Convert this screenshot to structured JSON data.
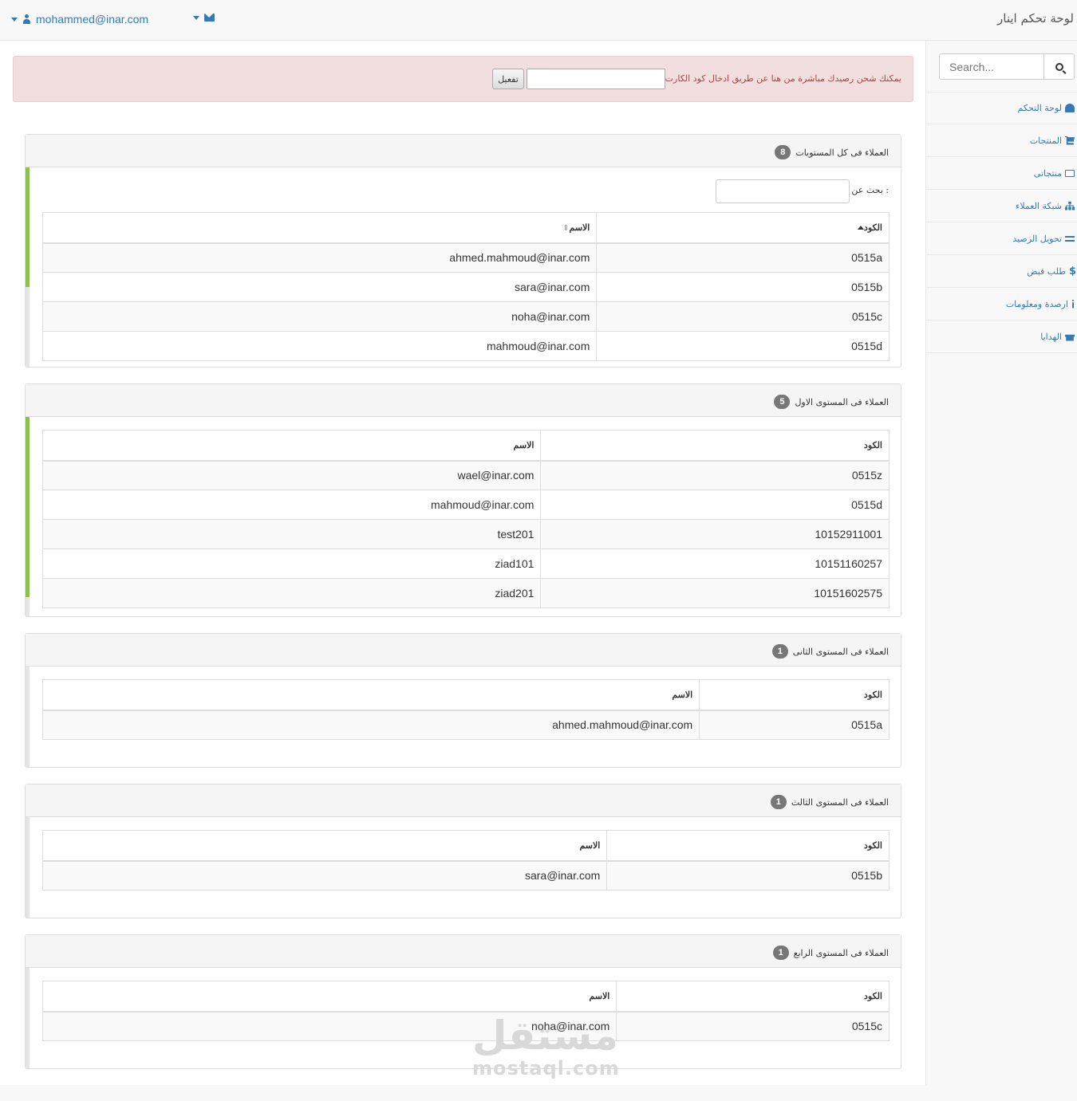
{
  "navbar": {
    "brand": "لوحة تحكم اينار",
    "user_email": "mohammed@inar.com"
  },
  "sidebar": {
    "search_placeholder": "Search...",
    "items": [
      {
        "label": "لوحة التحكم",
        "icon": "dashboard-icon"
      },
      {
        "label": "المنتجات",
        "icon": "shopping-cart-icon"
      },
      {
        "label": "منتجاتى",
        "icon": "folder-open-icon"
      },
      {
        "label": "شبكة العملاء",
        "icon": "sitemap-icon"
      },
      {
        "label": "تحويل الرصيد",
        "icon": "exchange-icon"
      },
      {
        "label": "طلب قبض",
        "icon": "dollar-icon"
      },
      {
        "label": "ارصدة ومعلومات",
        "icon": "info-icon"
      },
      {
        "label": "الهدايا",
        "icon": "gift-icon"
      }
    ]
  },
  "alert": {
    "text": "يمكنك شحن رصيدك مباشرة من هنا عن طريق ادخال كود الكارت",
    "button": "تفعيل",
    "card_code_value": ""
  },
  "panels": [
    {
      "title": "العملاء فى كل المستويات",
      "badge": "8",
      "search_label": "بحث عن :",
      "headers": {
        "code": "الكود",
        "name": "الاسم"
      },
      "rows": [
        {
          "code": "0515a",
          "name": "ahmed.mahmoud@inar.com"
        },
        {
          "code": "0515b",
          "name": "sara@inar.com"
        },
        {
          "code": "0515c",
          "name": "noha@inar.com"
        },
        {
          "code": "0515d",
          "name": "mahmoud@inar.com"
        }
      ]
    },
    {
      "title": "العملاء فى المستوى الاول",
      "badge": "5",
      "headers": {
        "code": "الكود",
        "name": "الاسم"
      },
      "rows": [
        {
          "code": "0515z",
          "name": "wael@inar.com"
        },
        {
          "code": "0515d",
          "name": "mahmoud@inar.com"
        },
        {
          "code": "10152911001",
          "name": "test201"
        },
        {
          "code": "10151160257",
          "name": "ziad101"
        },
        {
          "code": "10151602575",
          "name": "ziad201"
        }
      ]
    },
    {
      "title": "العملاء فى المستوى الثانى",
      "badge": "1",
      "headers": {
        "code": "الكود",
        "name": "الاسم"
      },
      "rows": [
        {
          "code": "0515a",
          "name": "ahmed.mahmoud@inar.com"
        }
      ]
    },
    {
      "title": "العملاء فى المستوى الثالث",
      "badge": "1",
      "headers": {
        "code": "الكود",
        "name": "الاسم"
      },
      "rows": [
        {
          "code": "0515b",
          "name": "sara@inar.com"
        }
      ]
    },
    {
      "title": "العملاء فى المستوى الرابع",
      "badge": "1",
      "headers": {
        "code": "الكود",
        "name": "الاسم"
      },
      "rows": [
        {
          "code": "0515c",
          "name": "noha@inar.com"
        }
      ]
    }
  ],
  "watermark": {
    "logo": "مستقل",
    "url": "mostaql.com"
  }
}
